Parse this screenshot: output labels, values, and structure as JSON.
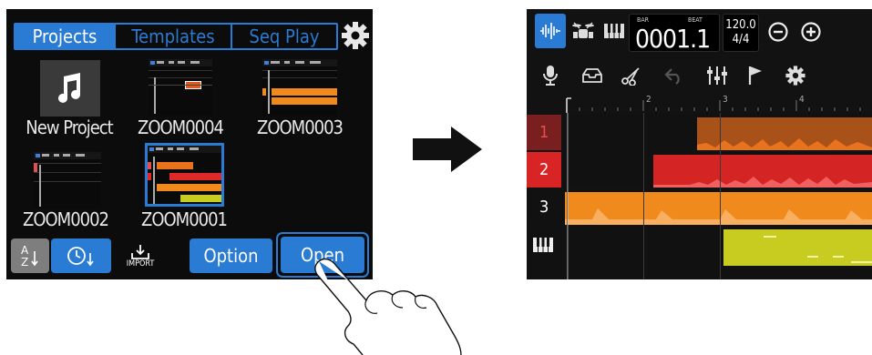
{
  "left_screen": {
    "tabs": [
      {
        "label": "Projects",
        "active": true
      },
      {
        "label": "Templates",
        "active": false
      },
      {
        "label": "Seq Play",
        "active": false
      }
    ],
    "projects": [
      {
        "name": "New Project",
        "icon": "music-note-icon"
      },
      {
        "name": "ZOOM0004"
      },
      {
        "name": "ZOOM0003"
      },
      {
        "name": "ZOOM0002"
      },
      {
        "name": "ZOOM0001",
        "selected": true
      }
    ],
    "bottom": {
      "sort_alpha_label": "A/Z",
      "sort_time_icon": "clock-icon",
      "import_label": "IMPORT",
      "option_label": "Option",
      "open_label": "Open"
    },
    "colors": {
      "accent": "#2a7bd3",
      "background": "#0c0c0c"
    }
  },
  "right_screen": {
    "counter": {
      "bar_label": "BAR",
      "beat_label": "BEAT",
      "value": "0001.1"
    },
    "tempo": {
      "bpm": "120.0",
      "signature": "4/4"
    },
    "ruler_marks": [
      "2",
      "3",
      "4"
    ],
    "tracks": [
      {
        "label": "1",
        "color": "#e8731c",
        "label_color": "#e05050"
      },
      {
        "label": "2",
        "color": "#e02828",
        "label_color": "#ffffff"
      },
      {
        "label": "3",
        "color": "#f08a1c",
        "label_color": "#ffffff"
      },
      {
        "label": "",
        "icon": "piano-keys-icon",
        "color": "#c8cc20"
      }
    ]
  }
}
